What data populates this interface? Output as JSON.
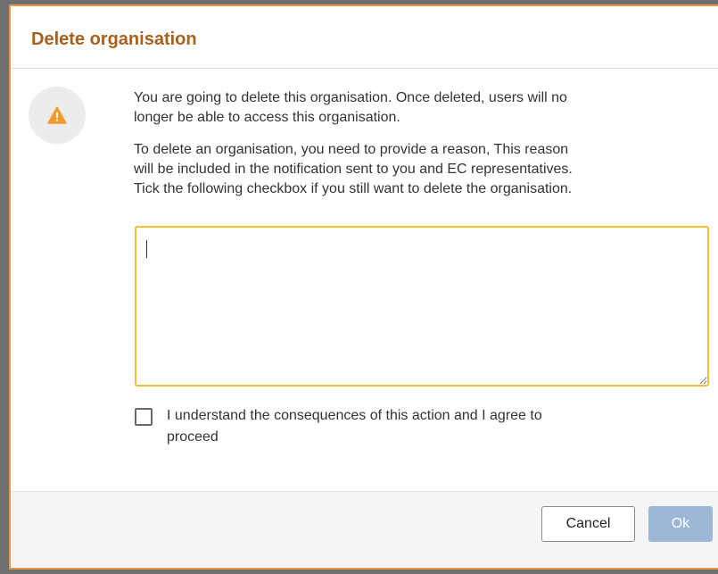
{
  "dialog": {
    "title": "Delete organisation",
    "icon": "warning-icon",
    "paragraphs": [
      "You are going to delete this organisation. Once deleted, users will no\nlonger be able to access this organisation.",
      "To delete an organisation, you need to provide a reason, This reason\nwill be included in the notification sent to you and EC representatives.\nTick the following checkbox if you still want to delete the organisation."
    ],
    "reason_value": "",
    "consent_label": "I understand the consequences of this action and I agree to\nproceed",
    "consent_checked": false,
    "cancel_label": "Cancel",
    "ok_label": "Ok"
  },
  "colors": {
    "title": "#a7611a",
    "border": "#e39a43",
    "warning": "#f39c2c",
    "textarea_border": "#f0c233",
    "ok_disabled": "#9db8d6"
  }
}
